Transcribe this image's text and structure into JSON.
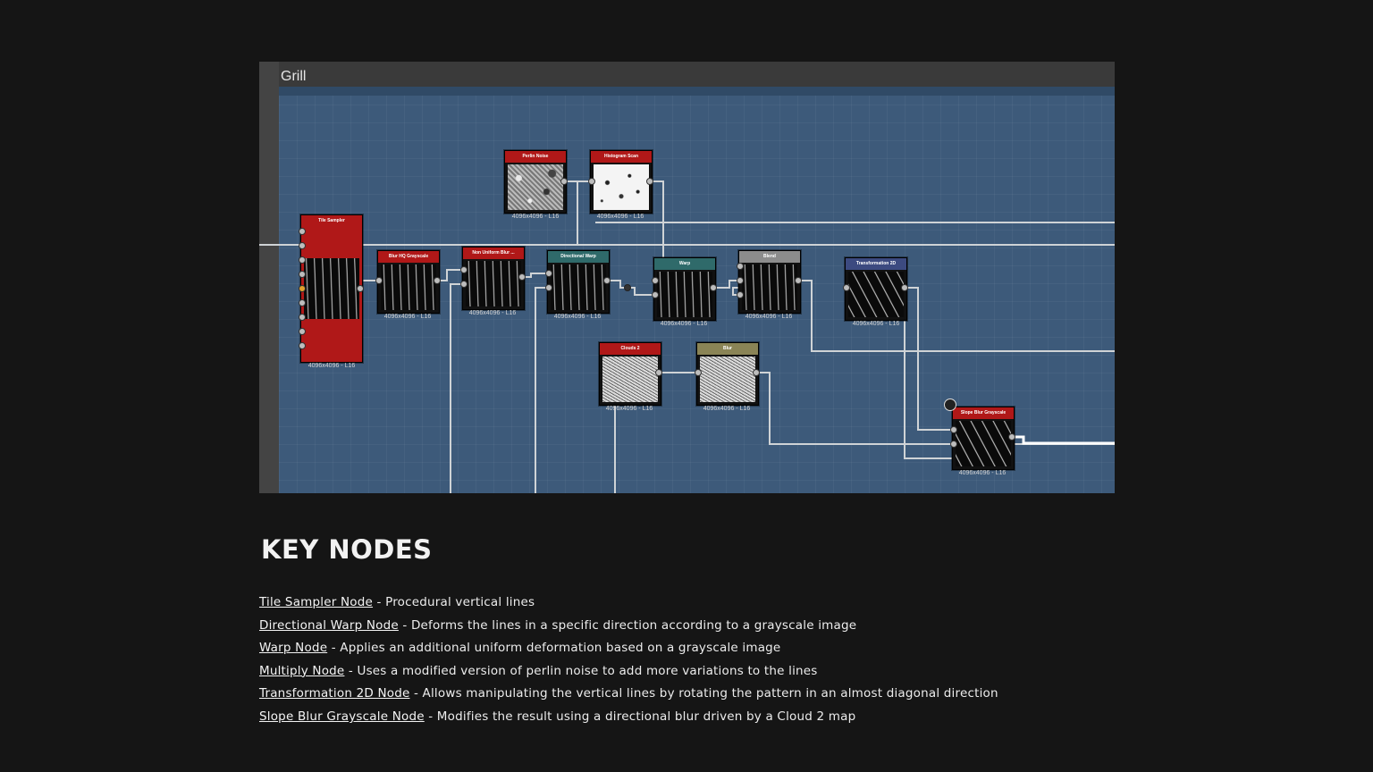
{
  "graph": {
    "title": "Grill",
    "nodes": [
      {
        "id": "tile-sampler",
        "title": "Tile Sampler",
        "resolution": "4096x4096 - L16",
        "header_color": "#b01818"
      },
      {
        "id": "blur-hq",
        "title": "Blur HQ Grayscale",
        "resolution": "4096x4096 - L16",
        "header_color": "#b01818"
      },
      {
        "id": "non-uniform-blur",
        "title": "Non Uniform Blur ...",
        "resolution": "4096x4096 - L16",
        "header_color": "#b01818"
      },
      {
        "id": "directional-warp",
        "title": "Directional Warp",
        "resolution": "4096x4096 - L16",
        "header_color": "#2f6a6a"
      },
      {
        "id": "warp",
        "title": "Warp",
        "resolution": "4096x4096 - L16",
        "header_color": "#2f6a6a"
      },
      {
        "id": "blend",
        "title": "Blend",
        "resolution": "4096x4096 - L16",
        "header_color": "#8c8c8c"
      },
      {
        "id": "transformation-2d",
        "title": "Transformation 2D",
        "resolution": "4096x4096 - L16",
        "header_color": "#3c4a80"
      },
      {
        "id": "perlin-noise",
        "title": "Perlin Noise",
        "resolution": "4096x4096 - L16",
        "header_color": "#b01818"
      },
      {
        "id": "histogram-scan",
        "title": "Histogram Scan",
        "resolution": "4096x4096 - L16",
        "header_color": "#b01818"
      },
      {
        "id": "clouds-2",
        "title": "Clouds 2",
        "resolution": "4096x4096 - L16",
        "header_color": "#b01818"
      },
      {
        "id": "blur",
        "title": "Blur",
        "resolution": "4096x4096 - L16",
        "header_color": "#8a8456"
      },
      {
        "id": "slope-blur",
        "title": "Slope Blur Grayscale",
        "resolution": "4096x4096 - L16",
        "header_color": "#b01818"
      }
    ]
  },
  "key_nodes": {
    "heading": "KEY NODES",
    "items": [
      {
        "name": "Tile Sampler Node",
        "desc": " - Procedural vertical lines"
      },
      {
        "name": "Directional Warp Node",
        "desc": " - Deforms the lines in a specific direction according to a grayscale image"
      },
      {
        "name": "Warp Node",
        "desc": " - Applies an additional uniform deformation based on a grayscale image"
      },
      {
        "name": "Multiply Node",
        "desc": " - Uses a modified version of perlin noise to add more variations to the lines"
      },
      {
        "name": "Transformation 2D Node",
        "desc": " - Allows manipulating the vertical lines by rotating the pattern in an almost diagonal direction"
      },
      {
        "name": "Slope Blur Grayscale Node",
        "desc": " - Modifies the result using a directional blur driven by a Cloud 2 map"
      }
    ]
  }
}
